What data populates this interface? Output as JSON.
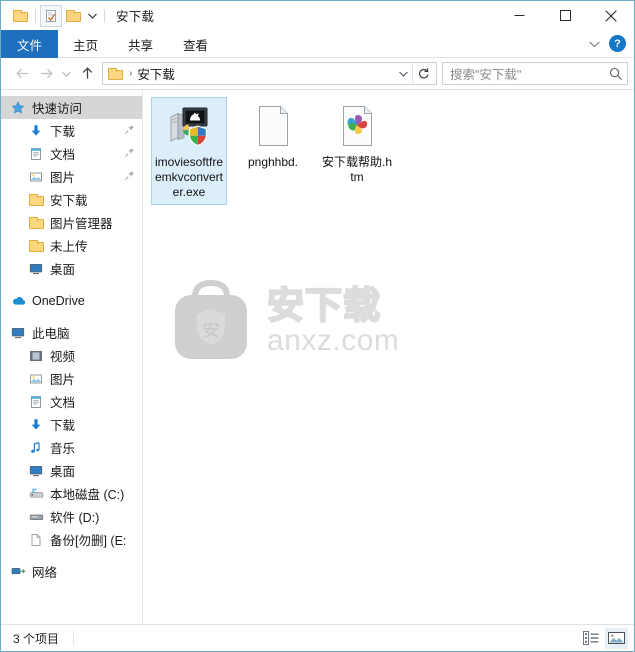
{
  "window": {
    "title": "安下载",
    "quick_access_toolbar": [
      {
        "name": "folder-icon",
        "label": "属性"
      },
      {
        "name": "properties-checkmark-icon",
        "label": "属性",
        "active": true
      },
      {
        "name": "new-folder-icon",
        "label": "新建文件夹"
      },
      {
        "name": "chevron-down-icon",
        "label": "自定义快速访问工具栏"
      }
    ],
    "controls": {
      "minimize": "—",
      "maximize": "□",
      "close": "✕"
    }
  },
  "ribbon": {
    "tabs": [
      {
        "label": "文件",
        "active": true
      },
      {
        "label": "主页",
        "active": false
      },
      {
        "label": "共享",
        "active": false
      },
      {
        "label": "查看",
        "active": false
      }
    ],
    "collapse_label": "⌄",
    "help_label": "?"
  },
  "nav": {
    "back": "←",
    "forward": "→",
    "recent": "⌄",
    "up": "↑",
    "breadcrumb": {
      "folder_icon": "folder-icon",
      "separator": "›",
      "path": "安下载"
    },
    "address_dropdown": "⌄",
    "refresh": "↻"
  },
  "search": {
    "placeholder": "搜索\"安下载\"",
    "icon": "search-icon"
  },
  "sidebar": {
    "groups": [
      {
        "header": {
          "label": "快速访问",
          "icon": "pin-star-icon",
          "selected": true
        },
        "items": [
          {
            "label": "下载",
            "icon": "download-arrow-icon",
            "pinned": true
          },
          {
            "label": "文档",
            "icon": "documents-icon",
            "pinned": true
          },
          {
            "label": "图片",
            "icon": "pictures-icon",
            "pinned": true
          },
          {
            "label": "安下载",
            "icon": "folder-icon",
            "pinned": false
          },
          {
            "label": "图片管理器",
            "icon": "folder-icon",
            "pinned": false
          },
          {
            "label": "未上传",
            "icon": "folder-icon",
            "pinned": false
          },
          {
            "label": "桌面",
            "icon": "desktop-icon",
            "pinned": false
          }
        ]
      },
      {
        "header": {
          "label": "OneDrive",
          "icon": "onedrive-cloud-icon",
          "selected": false
        },
        "items": []
      },
      {
        "header": {
          "label": "此电脑",
          "icon": "this-pc-icon",
          "selected": false
        },
        "items": [
          {
            "label": "视频",
            "icon": "videos-icon",
            "pinned": false
          },
          {
            "label": "图片",
            "icon": "pictures-icon",
            "pinned": false
          },
          {
            "label": "文档",
            "icon": "documents-icon",
            "pinned": false
          },
          {
            "label": "下载",
            "icon": "download-arrow-icon",
            "pinned": false
          },
          {
            "label": "音乐",
            "icon": "music-note-icon",
            "pinned": false
          },
          {
            "label": "桌面",
            "icon": "desktop-icon",
            "pinned": false
          },
          {
            "label": "本地磁盘 (C:)",
            "icon": "system-drive-icon",
            "pinned": false
          },
          {
            "label": "软件 (D:)",
            "icon": "drive-icon",
            "pinned": false
          },
          {
            "label": "备份[勿删] (E:",
            "icon": "blank-drive-icon",
            "pinned": false
          }
        ]
      },
      {
        "header": {
          "label": "网络",
          "icon": "network-icon",
          "selected": false
        },
        "items": []
      }
    ]
  },
  "files": [
    {
      "name": "imoviesoftfreemkvconverter.exe",
      "icon": "installer-exe-icon",
      "selected": true
    },
    {
      "name": "pnghhbd.",
      "icon": "blank-file-icon",
      "selected": false
    },
    {
      "name": "安下载帮助.htm",
      "icon": "html-pinwheel-icon",
      "selected": false
    }
  ],
  "watermark": {
    "logo": "anxz-bag-shield-logo",
    "shield_char": "安",
    "cn_text": "安下载",
    "en_text": "anxz.com"
  },
  "statusbar": {
    "item_count": "3 个项目",
    "views": [
      {
        "name": "details-view-button",
        "label": "详细信息",
        "active": false
      },
      {
        "name": "large-icons-view-button",
        "label": "大图标",
        "active": true
      }
    ]
  },
  "colors": {
    "accent": "#1e6fbe",
    "window_border": "#6eadc4",
    "selection": "#ddeefb",
    "selection_border": "#a9d3f0",
    "nav_selected": "#d6d6d6",
    "watermark": "#dcdcdc"
  }
}
